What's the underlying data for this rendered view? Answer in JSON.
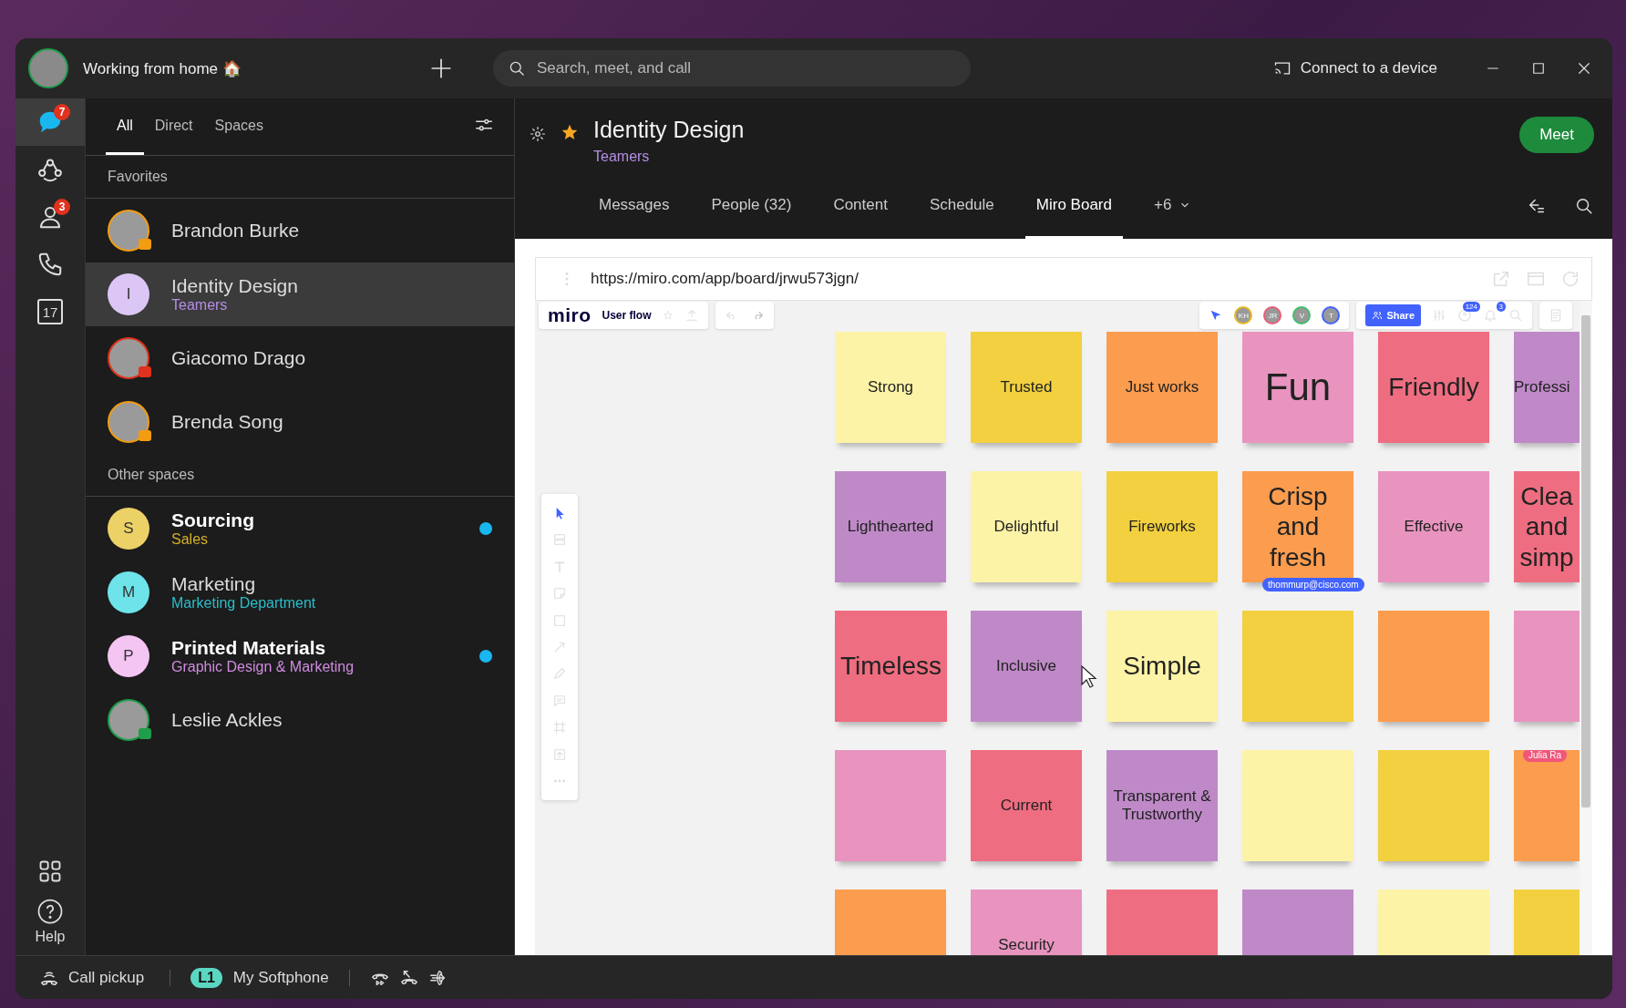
{
  "title_bar": {
    "status": "Working from home 🏠",
    "search": {
      "placeholder": "Search, meet, and call"
    },
    "connect": "Connect to a device"
  },
  "rail": {
    "items": [
      {
        "kind": "messaging",
        "selected": true,
        "badge": "7"
      },
      {
        "kind": "teams",
        "selected": false
      },
      {
        "kind": "contacts",
        "selected": false,
        "badge": "3"
      },
      {
        "kind": "calls",
        "selected": false
      },
      {
        "kind": "calendar",
        "selected": false,
        "day": "17"
      }
    ],
    "help": "Help"
  },
  "list": {
    "tabs": [
      {
        "label": "All",
        "selected": true
      },
      {
        "label": "Direct",
        "selected": false
      },
      {
        "label": "Spaces",
        "selected": false
      }
    ],
    "sections": [
      {
        "title": "Favorites",
        "items": [
          {
            "kind": "person",
            "name": "Brandon Burke",
            "color": "#f39c12",
            "selected": false,
            "unread": false
          },
          {
            "kind": "space",
            "name": "Identity Design",
            "subtitle": {
              "text": "Teamers",
              "color": "#b58ee6"
            },
            "letter": "I",
            "color": "#dcc6f5",
            "selected": true,
            "unread": false
          },
          {
            "kind": "person",
            "name": "Giacomo Drago",
            "color": "#e0321e",
            "selected": false,
            "unread": false
          },
          {
            "kind": "person",
            "name": "Brenda Song",
            "color": "#f39c12",
            "selected": false,
            "unread": false
          }
        ]
      },
      {
        "title": "Other spaces",
        "items": [
          {
            "kind": "space",
            "name": "Sourcing",
            "subtitle": {
              "text": "Sales",
              "color": "#d4b02c"
            },
            "letter": "S",
            "color": "#ecd166",
            "selected": false,
            "unread": true
          },
          {
            "kind": "space",
            "name": "Marketing",
            "subtitle": {
              "text": "Marketing Department",
              "color": "#2bbdc9"
            },
            "letter": "M",
            "color": "#6ee3ea",
            "selected": false,
            "unread": false
          },
          {
            "kind": "space",
            "name": "Printed Materials",
            "subtitle": {
              "text": "Graphic Design & Marketing",
              "color": "#d08be0"
            },
            "letter": "P",
            "color": "#f4c4f2",
            "selected": false,
            "unread": true
          },
          {
            "kind": "person",
            "name": "Leslie Ackles",
            "color": "#1f9d4a",
            "selected": false,
            "unread": false
          }
        ]
      }
    ]
  },
  "space": {
    "title": "Identity Design",
    "team": "Teamers",
    "favorite": true,
    "meet": "Meet",
    "tabs": [
      {
        "label": "Messages",
        "selected": false
      },
      {
        "label": "People (32)",
        "selected": false
      },
      {
        "label": "Content",
        "selected": false
      },
      {
        "label": "Schedule",
        "selected": false
      },
      {
        "label": "Miro Board",
        "selected": true
      }
    ],
    "more": "+6"
  },
  "browser": {
    "url": "https://miro.com/app/board/jrwu573jgn/"
  },
  "miro": {
    "logo": "miro",
    "board": "User flow",
    "collaborators": [
      {
        "initials": "KH",
        "color": "#e8b923"
      },
      {
        "initials": "JR",
        "color": "#e85d75"
      },
      {
        "initials": "V",
        "color": "#3fbf6a"
      },
      {
        "initials": "T",
        "color": "#4262ff"
      }
    ],
    "share": "Share",
    "help_count": "124",
    "notifications": "3",
    "notes": [
      {
        "kind": "small",
        "text": "Strong",
        "color": "#fdf3a7"
      },
      {
        "kind": "small",
        "text": "Trusted",
        "color": "#f2d03f"
      },
      {
        "kind": "small",
        "text": "Just works",
        "color": "#fb9c4f"
      },
      {
        "kind": "large",
        "text": "Fun",
        "color": "#e894bf"
      },
      {
        "kind": "medium",
        "text": "Friendly",
        "color": "#ef6d80"
      },
      {
        "kind": "small",
        "text": "Professi",
        "color": "#bf89c8"
      },
      {
        "kind": "small",
        "text": "Lighthearted",
        "color": "#bf89c8"
      },
      {
        "kind": "small",
        "text": "Delightful",
        "color": "#fdf3a7"
      },
      {
        "kind": "small",
        "text": "Fireworks",
        "color": "#f2d03f"
      },
      {
        "kind": "medium",
        "text": "Crisp and fresh",
        "color": "#fb9c4f",
        "cursor_label": "thommurp@cisco.com"
      },
      {
        "kind": "small",
        "text": "Effective",
        "color": "#e894bf"
      },
      {
        "kind": "medium",
        "text": "Clea and simp",
        "color": "#ef6d80"
      },
      {
        "kind": "medium",
        "text": "Timeless",
        "color": "#ef6d80"
      },
      {
        "kind": "small",
        "text": "Inclusive",
        "color": "#bf89c8"
      },
      {
        "kind": "medium",
        "text": "Simple",
        "color": "#fdf3a7"
      },
      {
        "kind": "small",
        "color": "#f2d03f"
      },
      {
        "kind": "small",
        "color": "#fb9c4f"
      },
      {
        "kind": "small",
        "color": "#e894bf"
      },
      {
        "kind": "small",
        "color": "#e894bf"
      },
      {
        "kind": "small",
        "text": "Current",
        "color": "#ef6d80"
      },
      {
        "kind": "small",
        "text": "Transparent & Trustworthy",
        "color": "#bf89c8"
      },
      {
        "kind": "small",
        "color": "#fdf3a7"
      },
      {
        "kind": "small",
        "color": "#f2d03f"
      },
      {
        "kind": "small",
        "color": "#fb9c4f",
        "tag": "Julia Ra"
      },
      {
        "kind": "small",
        "color": "#fb9c4f"
      },
      {
        "kind": "small",
        "text": "Security",
        "color": "#e894bf"
      },
      {
        "kind": "small",
        "color": "#ef6d80"
      },
      {
        "kind": "small",
        "color": "#bf89c8"
      },
      {
        "kind": "small",
        "color": "#fdf3a7"
      },
      {
        "kind": "small",
        "color": "#f2d03f"
      }
    ]
  },
  "status_bar": {
    "pickup": "Call pickup",
    "line": "L1",
    "device": "My Softphone"
  }
}
